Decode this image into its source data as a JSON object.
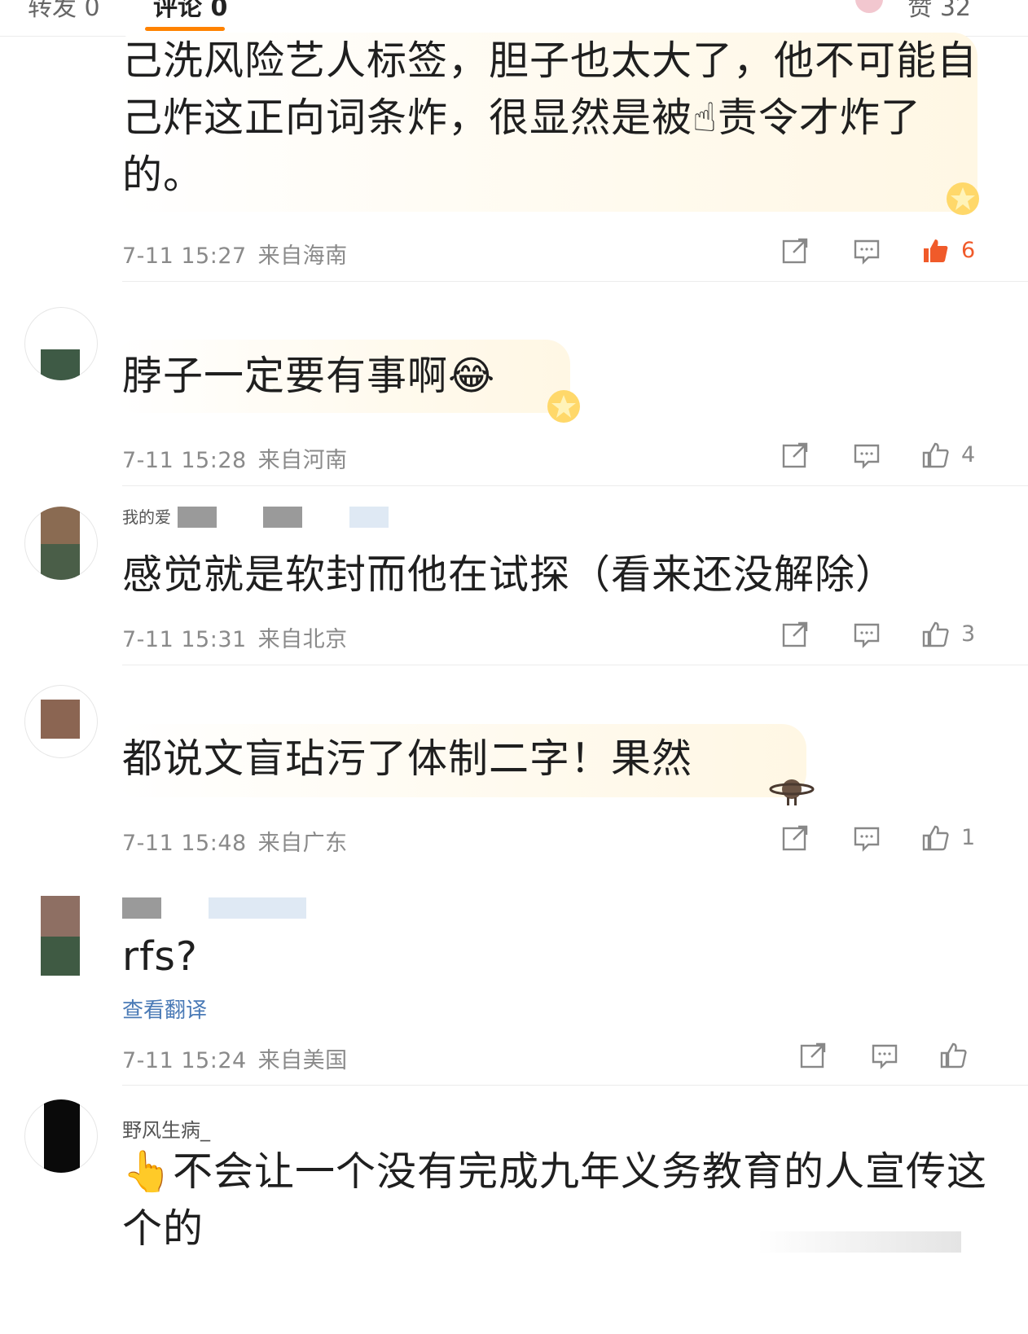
{
  "tabs": {
    "repost": "转发 0",
    "comment": "评论 0",
    "like": "赞 32"
  },
  "comments": [
    {
      "text": "己洗风险艺人标签，胆子也太大了，他不可能自己炸这正向词条炸，很显然是被☝责令才炸了的。",
      "time": "7-11 15:27",
      "location": "来自海南",
      "likes": "6",
      "liked": true
    },
    {
      "text": "脖子一定要有事啊😂",
      "time": "7-11 15:28",
      "location": "来自河南",
      "likes": "4"
    },
    {
      "username": "我的爱",
      "text": "感觉就是软封而他在试探（看来还没解除）",
      "time": "7-11 15:31",
      "location": "来自北京",
      "likes": "3"
    },
    {
      "text": "都说文盲玷污了体制二字！果然",
      "time": "7-11 15:48",
      "location": "来自广东",
      "likes": "1"
    },
    {
      "text": "rfs?",
      "translate": "查看翻译",
      "time": "7-11 15:24",
      "location": "来自美国",
      "likes": ""
    },
    {
      "username": "野风生病_",
      "text": "👆不会让一个没有完成九年义务教育的人宣传这个的"
    }
  ],
  "colors": {
    "accent": "#ff8200",
    "liked": "#f05a2a",
    "meta": "#8a8a8a",
    "link": "#4a7ab6"
  },
  "icons": [
    "repost-icon",
    "comment-icon",
    "like-icon"
  ]
}
